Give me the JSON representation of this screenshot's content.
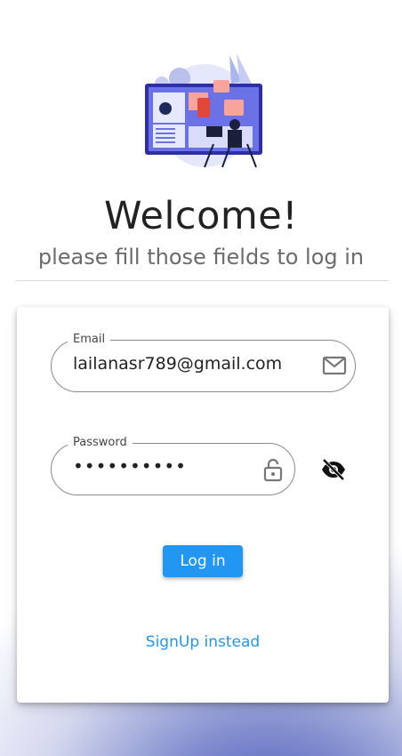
{
  "header": {
    "title": "Welcome!",
    "subtitle": "please fill those fields to log in"
  },
  "form": {
    "email": {
      "label": "Email",
      "value": "lailanasr789@gmail.com",
      "icon": "mail-icon"
    },
    "password": {
      "label": "Password",
      "value": "••••••••••",
      "icon": "lock-icon",
      "toggle_icon": "eye-off-icon"
    },
    "login_label": "Log in",
    "signup_label": "SignUp instead"
  },
  "colors": {
    "accent": "#2196f3",
    "background_glow": "#3f51b5"
  }
}
